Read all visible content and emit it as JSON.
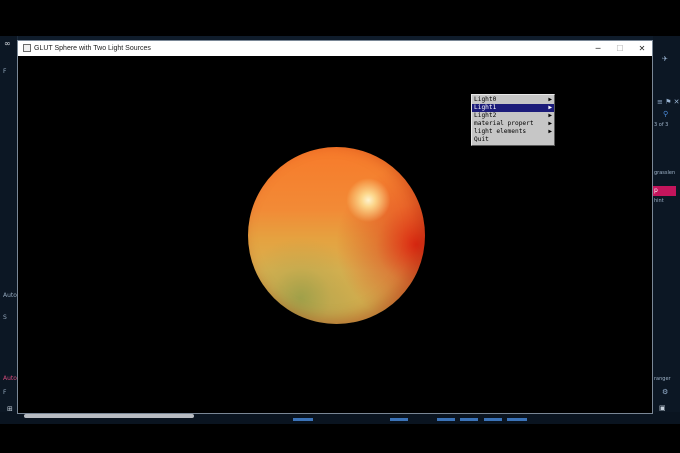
{
  "window": {
    "title": "GLUT Sphere with Two Light Sources",
    "minimize": "─",
    "maximize": "☐",
    "close": "✕"
  },
  "menu": {
    "items": [
      {
        "label": "Light0",
        "arrow": "▶",
        "selected": false
      },
      {
        "label": "Light1",
        "arrow": "▶",
        "selected": true
      },
      {
        "label": "Light2",
        "arrow": "▶",
        "selected": false
      },
      {
        "label": "material propert",
        "arrow": "▶",
        "selected": false
      },
      {
        "label": "light elements",
        "arrow": "▶",
        "selected": false
      },
      {
        "label": "Quit",
        "arrow": "",
        "selected": false
      }
    ]
  },
  "background": {
    "left_texts": [
      "F",
      "Auto",
      "S",
      "Auto",
      "F"
    ],
    "right_texts": [
      "3 of 3",
      "grasslen",
      "hint",
      "ranger"
    ],
    "right_badge": "p"
  },
  "colors": {
    "menu_bg": "#c6c6c6",
    "menu_selected": "#1c1c7a",
    "canvas_bg": "#000000",
    "sphere_main": "#f28a36",
    "sphere_highlight": "#fff6c8",
    "sphere_shadow": "#dc2a14"
  }
}
